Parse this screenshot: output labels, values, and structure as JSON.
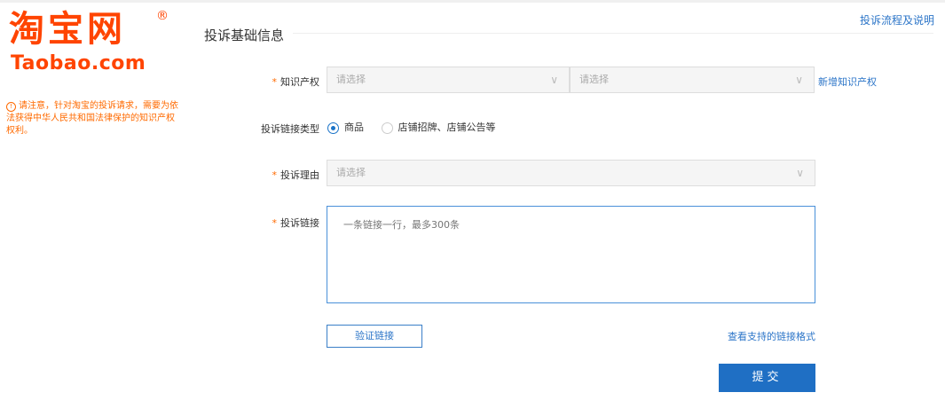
{
  "logo": {
    "cn": "淘宝网",
    "registered": "®",
    "en": "Taobao.com"
  },
  "notice": {
    "icon": "info-circle-icon",
    "text": "请注意，针对淘宝的投诉请求，需要为依法获得中华人民共和国法律保护的知识产权权利。"
  },
  "header": {
    "section_title": "投诉基础信息",
    "process_link": "投诉流程及说明"
  },
  "form": {
    "ip": {
      "required_mark": "*",
      "label": "知识产权",
      "select1_placeholder": "请选择",
      "select2_placeholder": "请选择",
      "add_link": "新增知识产权"
    },
    "link_type": {
      "label": "投诉链接类型",
      "option_goods": "商品",
      "option_shop": "店铺招牌、店铺公告等",
      "selected": "商品"
    },
    "reason": {
      "required_mark": "*",
      "label": "投诉理由",
      "placeholder": "请选择"
    },
    "links": {
      "required_mark": "*",
      "label": "投诉链接",
      "placeholder": "一条链接一行，最多300条"
    },
    "verify_button": "验证链接",
    "format_link": "查看支持的链接格式",
    "submit_button": "提交"
  },
  "colors": {
    "brand": "#ff4400",
    "accent": "#1f6fc4",
    "link": "#2c75c8",
    "notice": "#ff6a00"
  }
}
